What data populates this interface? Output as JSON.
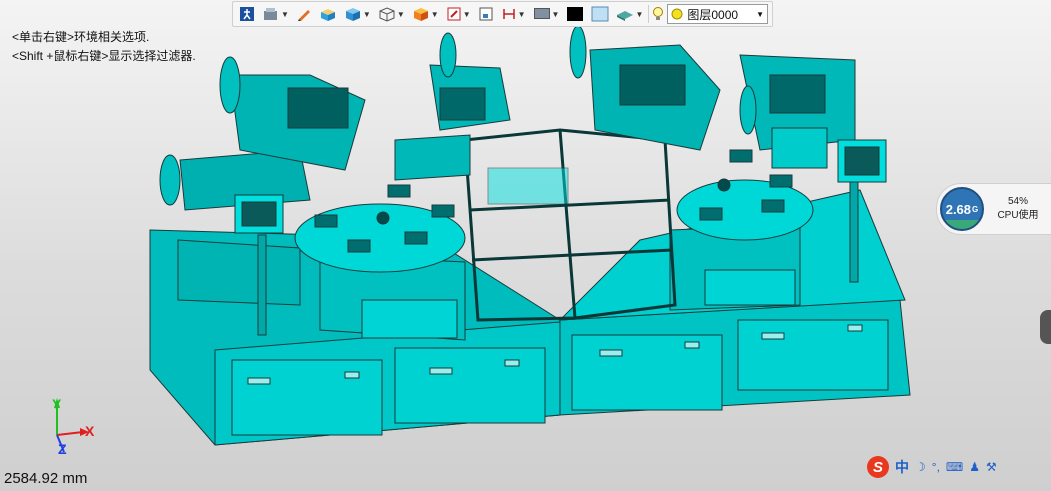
{
  "toolbar": {
    "items": [
      "walk-icon",
      "render-mode-icon",
      "pencil-icon",
      "box-solid-icon",
      "cube-shaded-icon",
      "cube-wire-icon",
      "cube-color-icon",
      "shading-icon",
      "view-fit-icon",
      "dimension-icon",
      "monitor-icon",
      "black-swatch",
      "lightblue-swatch",
      "plane-icon",
      "bulb-icon",
      "layer-dot-icon"
    ],
    "layer_label": "图层0000"
  },
  "hints": {
    "line1": "<单击右键>环境相关选项.",
    "line2": "<Shift +鼠标右键>显示选择过滤器."
  },
  "cpu": {
    "speed": "2.68",
    "unit": "G",
    "percent": "54%",
    "label": "CPU使用"
  },
  "ime": {
    "logo": "S",
    "mode": "中"
  },
  "status": {
    "measurement": "2584.92 mm"
  },
  "axes": {
    "x": "X",
    "y": "Y",
    "z": "Z"
  },
  "colors": {
    "model": "#00c8c8",
    "model_dark": "#008c8c",
    "edges": "#1a3a3a",
    "axis_x": "#e02020",
    "axis_y": "#20c020",
    "axis_z": "#2040e0"
  }
}
